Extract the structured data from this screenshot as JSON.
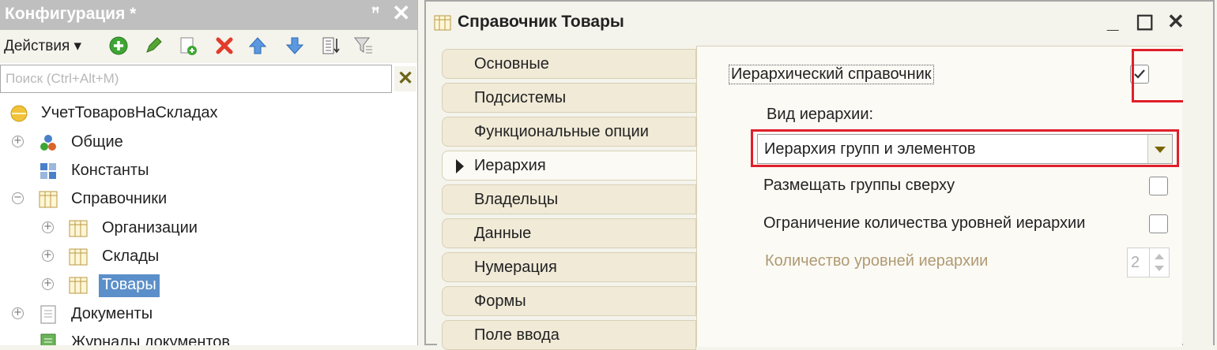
{
  "config_panel": {
    "title": "Конфигурация *",
    "actions_label": "Действия",
    "search_placeholder": "Поиск (Ctrl+Alt+M)",
    "tree": [
      {
        "label": "УчетТоваровНаСкладах",
        "icon": "config-root-icon"
      },
      {
        "label": "Общие",
        "icon": "common-icon"
      },
      {
        "label": "Константы",
        "icon": "constants-icon"
      },
      {
        "label": "Справочники",
        "icon": "catalogs-icon"
      },
      {
        "label": "Организации",
        "icon": "catalog-icon"
      },
      {
        "label": "Склады",
        "icon": "catalog-icon"
      },
      {
        "label": "Товары",
        "icon": "catalog-icon",
        "selected": true
      },
      {
        "label": "Документы",
        "icon": "documents-icon"
      },
      {
        "label": "Журналы документов",
        "icon": "journals-icon"
      }
    ]
  },
  "window": {
    "title": "Справочник Товары",
    "tabs": [
      "Основные",
      "Подсистемы",
      "Функциональные опции",
      "Иерархия",
      "Владельцы",
      "Данные",
      "Нумерация",
      "Формы",
      "Поле ввода"
    ],
    "active_tab": "Иерархия",
    "hierarchy": {
      "hierarchical_label": "Иерархический справочник",
      "hierarchical_checked": true,
      "kind_label": "Вид иерархии:",
      "kind_value": "Иерархия групп и элементов",
      "groups_on_top_label": "Размещать группы сверху",
      "groups_on_top_checked": false,
      "limit_levels_label": "Ограничение количества уровней иерархии",
      "limit_levels_checked": false,
      "levels_count_label": "Количество уровней иерархии",
      "levels_count_value": "2"
    }
  },
  "colors": {
    "highlight": "#e01f2a",
    "selection": "#5b8fc9"
  }
}
